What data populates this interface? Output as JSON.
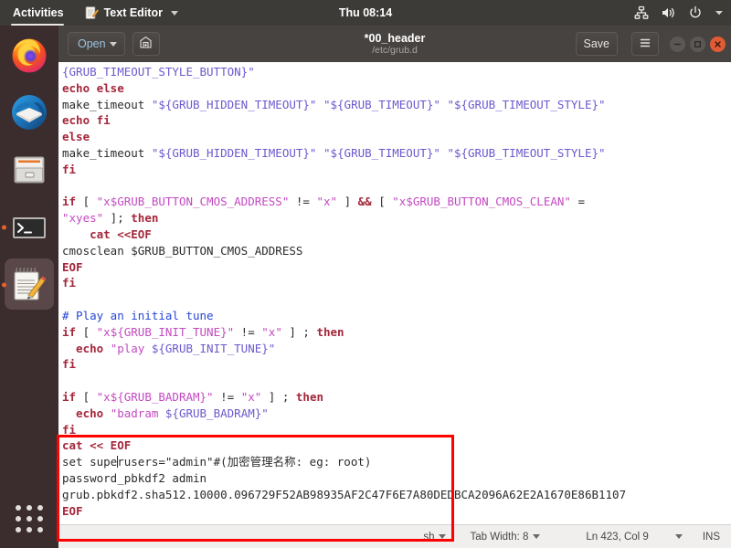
{
  "topbar": {
    "activities": "Activities",
    "app_name": "Text Editor",
    "app_icon": "notepad-pencil-icon",
    "clock": "Thu 08:14",
    "indicators": [
      "network-wired-icon",
      "volume-icon",
      "power-icon",
      "chevron-down-icon"
    ]
  },
  "dock": {
    "items": [
      {
        "name": "firefox",
        "icon": "firefox-icon",
        "running": false,
        "focused": false
      },
      {
        "name": "thunderbird",
        "icon": "thunderbird-icon",
        "running": false,
        "focused": false
      },
      {
        "name": "files",
        "icon": "file-cabinet-icon",
        "running": false,
        "focused": false
      },
      {
        "name": "terminal",
        "icon": "terminal-icon",
        "running": true,
        "focused": false
      },
      {
        "name": "text-editor",
        "icon": "notepad-pencil-icon",
        "running": true,
        "focused": true
      }
    ],
    "show_apps": "show-applications-icon"
  },
  "window": {
    "open_button": "Open",
    "open_caret": "chevron-down-icon",
    "save_as_icon": "save-as-icon",
    "title": "*00_header",
    "subtitle": "/etc/grub.d",
    "save_button": "Save",
    "menu_icon": "hamburger-menu-icon",
    "controls": [
      "minimize-icon",
      "maximize-icon",
      "close-icon"
    ]
  },
  "editor": {
    "lines": [
      [
        {
          "t": "{GRUB_TIMEOUT_STYLE_BUTTON}\"",
          "c": "var"
        }
      ],
      [
        {
          "t": "echo else",
          "c": "kw"
        }
      ],
      [
        {
          "t": "make_timeout ",
          "c": "plain"
        },
        {
          "t": "\"${GRUB_HIDDEN_TIMEOUT}\" \"${GRUB_TIMEOUT}\" \"${GRUB_TIMEOUT_STYLE}\"",
          "c": "var"
        }
      ],
      [
        {
          "t": "echo fi",
          "c": "kw"
        }
      ],
      [
        {
          "t": "else",
          "c": "kw"
        }
      ],
      [
        {
          "t": "make_timeout ",
          "c": "plain"
        },
        {
          "t": "\"${GRUB_HIDDEN_TIMEOUT}\" \"${GRUB_TIMEOUT}\" \"${GRUB_TIMEOUT_STYLE}\"",
          "c": "var"
        }
      ],
      [
        {
          "t": "fi",
          "c": "kw"
        }
      ],
      [
        {
          "t": "",
          "c": "plain"
        }
      ],
      [
        {
          "t": "if",
          "c": "kw"
        },
        {
          "t": " [ ",
          "c": "plain"
        },
        {
          "t": "\"x$GRUB_BUTTON_CMOS_ADDRESS\"",
          "c": "str"
        },
        {
          "t": " != ",
          "c": "plain"
        },
        {
          "t": "\"x\"",
          "c": "str"
        },
        {
          "t": " ] ",
          "c": "plain"
        },
        {
          "t": "&&",
          "c": "op"
        },
        {
          "t": " [ ",
          "c": "plain"
        },
        {
          "t": "\"x$GRUB_BUTTON_CMOS_CLEAN\"",
          "c": "str"
        },
        {
          "t": " =",
          "c": "plain"
        }
      ],
      [
        {
          "t": "\"xyes\"",
          "c": "str"
        },
        {
          "t": " ]; ",
          "c": "plain"
        },
        {
          "t": "then",
          "c": "kw"
        }
      ],
      [
        {
          "t": "    cat <<EOF",
          "c": "kw"
        }
      ],
      [
        {
          "t": "cmosclean $GRUB_BUTTON_CMOS_ADDRESS",
          "c": "plain"
        }
      ],
      [
        {
          "t": "EOF",
          "c": "kw"
        }
      ],
      [
        {
          "t": "fi",
          "c": "kw"
        }
      ],
      [
        {
          "t": "",
          "c": "plain"
        }
      ],
      [
        {
          "t": "# Play an initial tune",
          "c": "cmt"
        }
      ],
      [
        {
          "t": "if",
          "c": "kw"
        },
        {
          "t": " [ ",
          "c": "plain"
        },
        {
          "t": "\"x${GRUB_INIT_TUNE}\"",
          "c": "str"
        },
        {
          "t": " != ",
          "c": "plain"
        },
        {
          "t": "\"x\"",
          "c": "str"
        },
        {
          "t": " ] ; ",
          "c": "plain"
        },
        {
          "t": "then",
          "c": "kw"
        }
      ],
      [
        {
          "t": "  echo ",
          "c": "kw"
        },
        {
          "t": "\"play ",
          "c": "str"
        },
        {
          "t": "${GRUB_INIT_TUNE}\"",
          "c": "var"
        }
      ],
      [
        {
          "t": "fi",
          "c": "kw"
        }
      ],
      [
        {
          "t": "",
          "c": "plain"
        }
      ],
      [
        {
          "t": "if",
          "c": "kw"
        },
        {
          "t": " [ ",
          "c": "plain"
        },
        {
          "t": "\"x${GRUB_BADRAM}\"",
          "c": "str"
        },
        {
          "t": " != ",
          "c": "plain"
        },
        {
          "t": "\"x\"",
          "c": "str"
        },
        {
          "t": " ] ; ",
          "c": "plain"
        },
        {
          "t": "then",
          "c": "kw"
        }
      ],
      [
        {
          "t": "  echo ",
          "c": "kw"
        },
        {
          "t": "\"badram ",
          "c": "str"
        },
        {
          "t": "${GRUB_BADRAM}\"",
          "c": "var"
        }
      ],
      [
        {
          "t": "fi",
          "c": "kw"
        }
      ],
      [
        {
          "t": "cat << EOF",
          "c": "kw"
        }
      ],
      [
        {
          "t": "set supe",
          "c": "plain"
        },
        {
          "t": "|CURSOR|",
          "c": "cursor"
        },
        {
          "t": "rusers=\"admin\"#(加密管理名称: eg: root)",
          "c": "plain"
        }
      ],
      [
        {
          "t": "password_pbkdf2 admin",
          "c": "plain"
        }
      ],
      [
        {
          "t": "grub.pbkdf2.sha512.10000.096729F52AB98935AF2C47F6E7A80DEDBCA2096A62E2A1670E86B1107",
          "c": "plain"
        }
      ],
      [
        {
          "t": "EOF",
          "c": "kw"
        }
      ]
    ]
  },
  "statusbar": {
    "language": "sh",
    "language_caret": "chevron-down-icon",
    "tab_width": "Tab Width: 8",
    "tab_caret": "chevron-down-icon",
    "position": "Ln 423, Col 9",
    "position_caret": "chevron-down-icon",
    "insert_mode": "INS"
  },
  "annotation": {
    "highlight_color": "#fe0000",
    "note": "red-rectangle-highlight"
  }
}
